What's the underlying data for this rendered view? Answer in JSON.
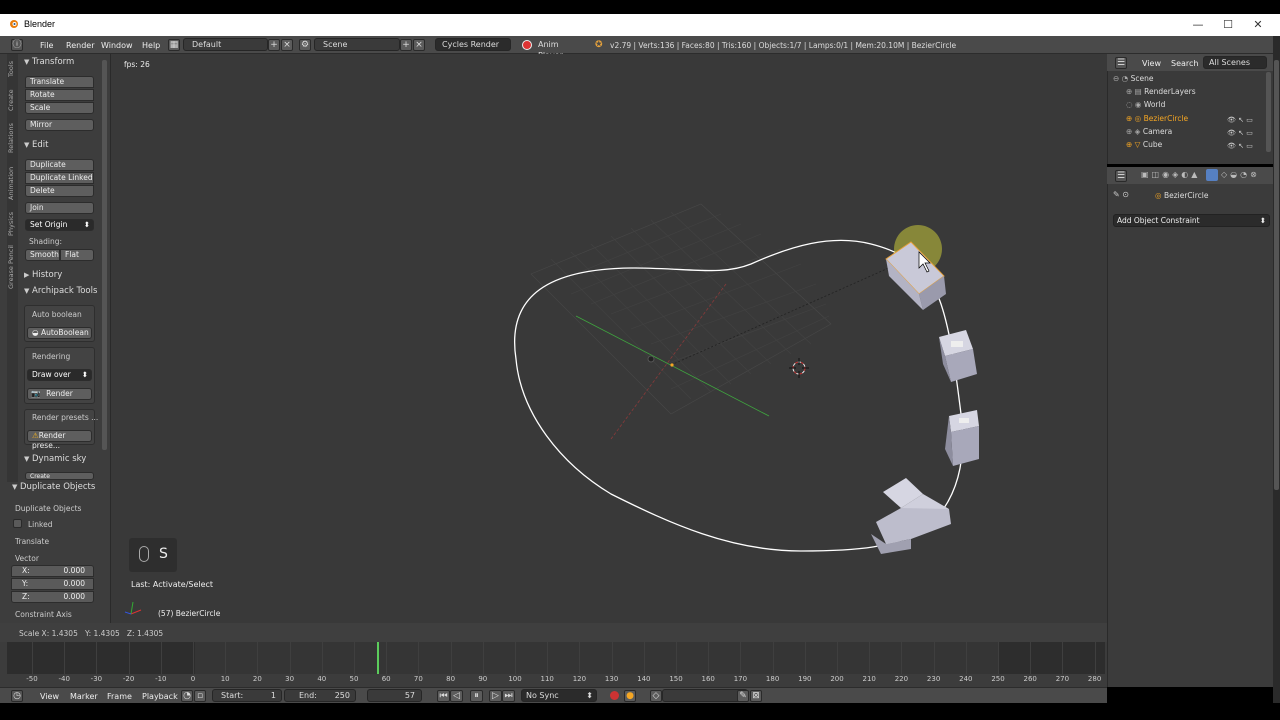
{
  "window": {
    "title": "Blender",
    "controls": [
      "—",
      "☐",
      "✕"
    ]
  },
  "infobar": {
    "menus": [
      "File",
      "Render",
      "Window",
      "Help"
    ],
    "screen_layout": "Default",
    "scene": "Scene",
    "render_engine": "Cycles Render",
    "anim_player": "Anim Player",
    "stats": "v2.79 | Verts:136 | Faces:80 | Tris:160 | Objects:1/7 | Lamps:0/1 | Mem:20.10M | BezierCircle"
  },
  "toolshelf": {
    "tabs": [
      "Tools",
      "Create",
      "Relations",
      "Animation",
      "Physics",
      "Grease Pencil"
    ],
    "transform": {
      "header": "Transform",
      "buttons": [
        "Translate",
        "Rotate",
        "Scale"
      ],
      "mirror": "Mirror"
    },
    "edit": {
      "header": "Edit",
      "buttons": [
        "Duplicate",
        "Duplicate Linked",
        "Delete"
      ],
      "join": "Join",
      "set_origin": "Set Origin",
      "shading_label": "Shading:",
      "smooth": "Smooth",
      "flat": "Flat"
    },
    "history": {
      "header": "History"
    },
    "archipack": {
      "header": "Archipack Tools",
      "auto_boolean_label": "Auto boolean",
      "auto_boolean_btn": "AutoBoolean",
      "rendering_label": "Rendering",
      "draw_over": "Draw over",
      "render_btn": "Render",
      "render_presets_label": "Render presets ...",
      "render_presets_btn": "Render prese..."
    },
    "dynamic_sky": {
      "header": "Dynamic sky",
      "create_btn": "Create"
    }
  },
  "operator_panel": {
    "header": "Duplicate Objects",
    "subtitle": "Duplicate Objects",
    "linked_label": "Linked",
    "translate_label": "Translate",
    "vector_label": "Vector",
    "x_label": "X:",
    "x_value": "0.000",
    "y_label": "Y:",
    "y_value": "0.000",
    "z_label": "Z:",
    "z_value": "0.000",
    "constraint_label": "Constraint Axis"
  },
  "viewport": {
    "fps": "fps: 26",
    "key_hint": "S",
    "last_op": "Last: Activate/Select",
    "object_label": "(57) BezierCircle",
    "status": "Scale X: 1.4305   Y: 1.4305   Z: 1.4305"
  },
  "timeline": {
    "ticks": [
      "-50",
      "-40",
      "-30",
      "-20",
      "-10",
      "0",
      "10",
      "20",
      "30",
      "40",
      "50",
      "60",
      "70",
      "80",
      "90",
      "100",
      "110",
      "120",
      "130",
      "140",
      "150",
      "160",
      "170",
      "180",
      "190",
      "200",
      "210",
      "220",
      "230",
      "240",
      "250",
      "260",
      "270",
      "280"
    ],
    "current_frame_value": 57,
    "menus": [
      "View",
      "Marker",
      "Frame",
      "Playback"
    ],
    "start_label": "Start:",
    "start_value": "1",
    "end_label": "End:",
    "end_value": "250",
    "current_frame": "57",
    "sync": "No Sync"
  },
  "outliner": {
    "tabs": [
      "View",
      "Search",
      "All Scenes"
    ],
    "items": [
      "Scene",
      "RenderLayers",
      "World",
      "BezierCircle",
      "Camera",
      "Cube"
    ]
  },
  "properties": {
    "object_name": "BezierCircle",
    "add_constraint": "Add Object Constraint"
  },
  "colors": {
    "accent_blue": "#5680c2",
    "selected_orange": "#f5a623",
    "curve": "#ffffff",
    "x_axis": "#b03a3a",
    "y_axis": "#3fa53f"
  }
}
